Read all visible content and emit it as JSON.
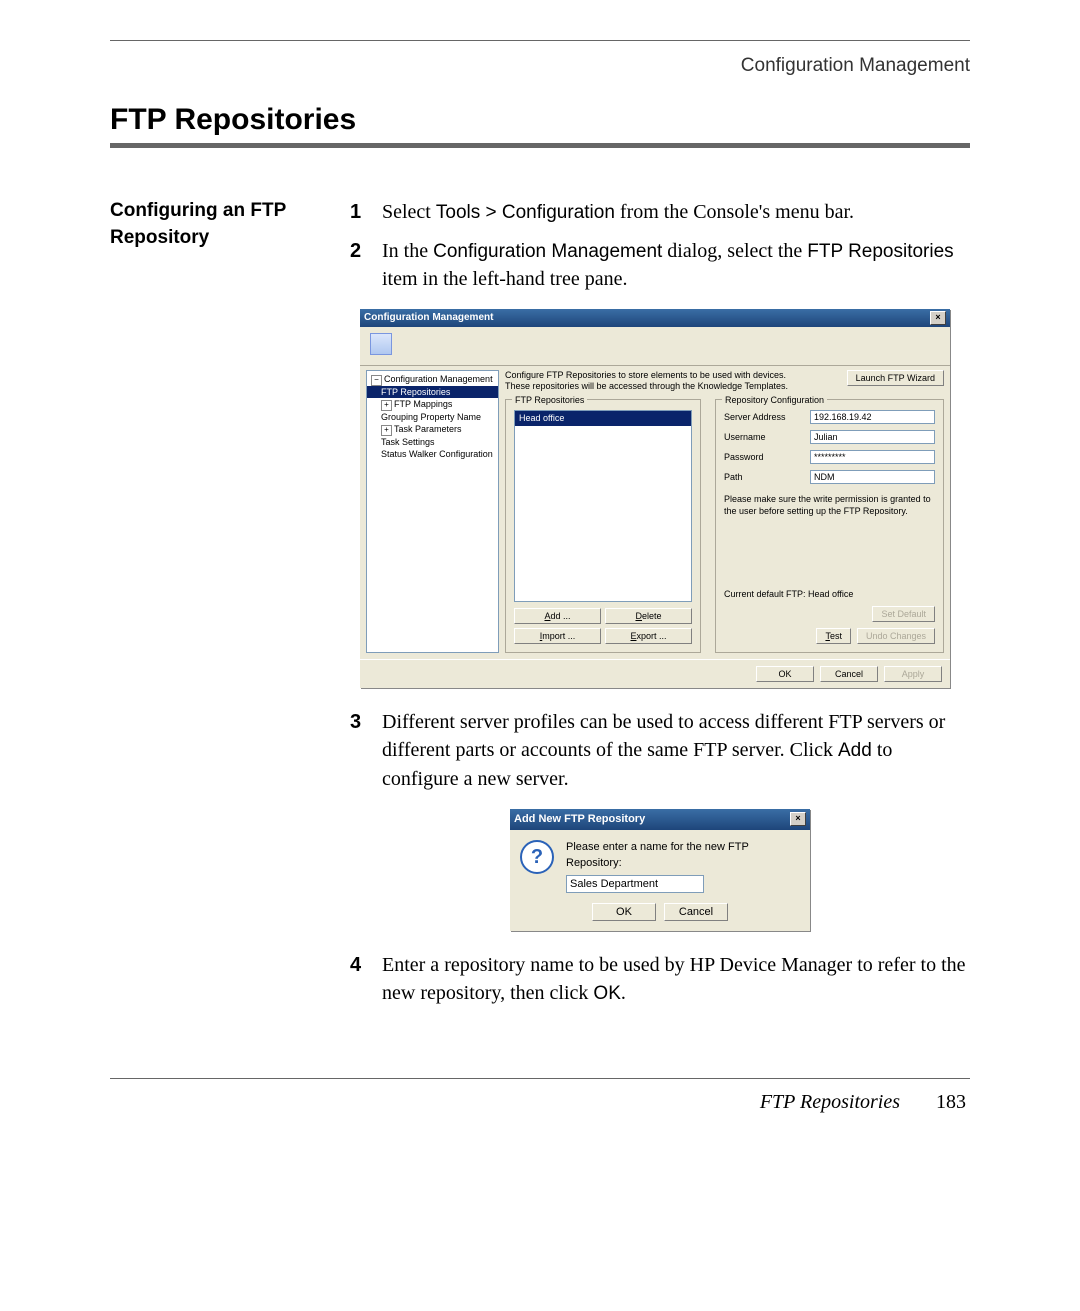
{
  "header": {
    "section": "Configuration Management"
  },
  "title": "FTP Repositories",
  "side_heading": "Configuring an FTP Repository",
  "steps": {
    "s1": {
      "num": "1",
      "pre": "Select ",
      "menu": "Tools > Configuration",
      "post": " from the Console's menu bar."
    },
    "s2": {
      "num": "2",
      "pre": "In the ",
      "term1": "Configuration Management",
      "mid": " dialog, select the ",
      "term2": "FTP Repositories",
      "post": " item in the left-hand tree pane."
    },
    "s3": {
      "num": "3",
      "pre": "Different server profiles can be used to access different FTP servers or different parts or accounts of the same FTP server. Click ",
      "term": "Add",
      "post": " to configure a new server."
    },
    "s4": {
      "num": "4",
      "pre": "Enter a repository name to be used by HP Device Manager to refer to the new repository, then click ",
      "term": "OK",
      "post": "."
    }
  },
  "dialog": {
    "title": "Configuration Management",
    "close": "×",
    "desc1": "Configure FTP Repositories to store elements to be used with devices.",
    "desc2": "These repositories will be accessed through the Knowledge Templates.",
    "launch_btn": "Launch FTP Wizard",
    "tree": {
      "root": "Configuration Management",
      "items": [
        "FTP Repositories",
        "FTP Mappings",
        "Grouping Property Name",
        "Task Parameters",
        "Task Settings",
        "Status Walker Configuration"
      ]
    },
    "repo_group": {
      "title": "FTP Repositories",
      "selected": "Head office",
      "add": "Add ...",
      "delete": "Delete",
      "import": "Import ...",
      "export": "Export ..."
    },
    "config_group": {
      "title": "Repository Configuration",
      "server_label": "Server Address",
      "server_value": "192.168.19.42",
      "user_label": "Username",
      "user_value": "Julian",
      "pass_label": "Password",
      "pass_value": "*********",
      "path_label": "Path",
      "path_value": "NDM",
      "hint": "Please make sure the write permission is granted to the user before setting up the FTP Repository.",
      "current_default": "Current default FTP: Head office",
      "set_default": "Set Default",
      "test": "Test",
      "undo": "Undo Changes"
    },
    "footer": {
      "ok": "OK",
      "cancel": "Cancel",
      "apply": "Apply"
    }
  },
  "small_dialog": {
    "title": "Add New FTP Repository",
    "close": "×",
    "prompt": "Please enter a name for the new FTP Repository:",
    "value": "Sales Department",
    "ok": "OK",
    "cancel": "Cancel"
  },
  "footer": {
    "left": "FTP Repositories",
    "page": "183"
  }
}
